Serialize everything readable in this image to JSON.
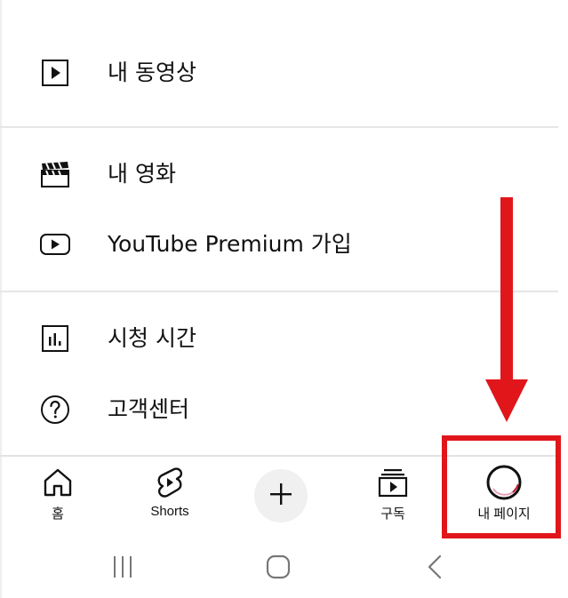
{
  "menu": {
    "items": [
      {
        "label": "내 동영상",
        "icon": "play-square-icon"
      },
      {
        "label": "내 영화",
        "icon": "clapperboard-icon"
      },
      {
        "label": "YouTube Premium 가입",
        "icon": "youtube-play-icon"
      },
      {
        "label": "시청 시간",
        "icon": "bar-chart-icon"
      },
      {
        "label": "고객센터",
        "icon": "help-circle-icon"
      }
    ]
  },
  "bottom_nav": {
    "home": {
      "label": "홈",
      "icon": "home-icon"
    },
    "shorts": {
      "label": "Shorts",
      "icon": "shorts-icon"
    },
    "create": {
      "icon": "plus-icon"
    },
    "subscriptions": {
      "label": "구독",
      "icon": "subscriptions-icon"
    },
    "library": {
      "label": "내 페이지",
      "icon": "profile-avatar-icon"
    }
  },
  "annotation": {
    "color": "#e0161b",
    "icon": "arrow-down-icon"
  },
  "system_nav": {
    "recent": {
      "icon": "recent-apps-icon"
    },
    "home": {
      "icon": "system-home-icon"
    },
    "back": {
      "icon": "back-icon"
    }
  }
}
